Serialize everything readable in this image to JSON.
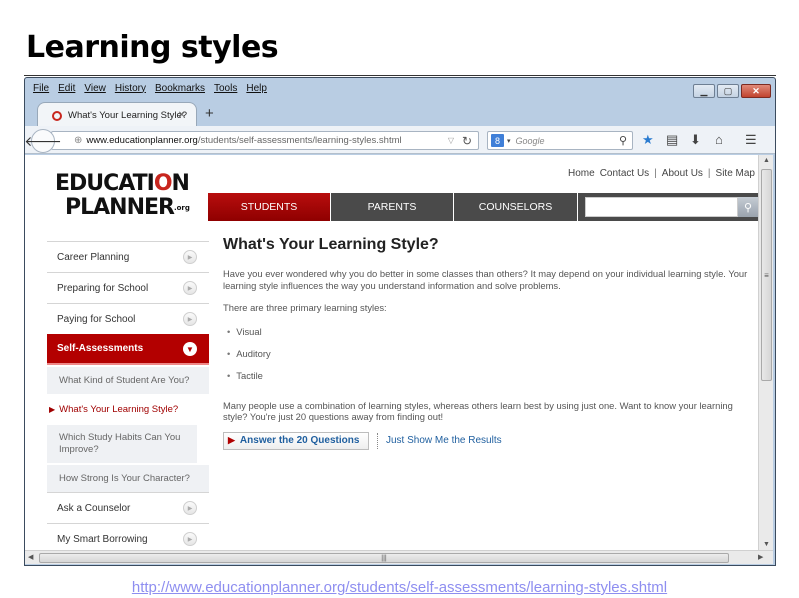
{
  "slide": {
    "title": "Learning styles",
    "source_url": "http://www.educationplanner.org/students/self-assessments/learning-styles.shtml"
  },
  "browser": {
    "menu": [
      "File",
      "Edit",
      "View",
      "History",
      "Bookmarks",
      "Tools",
      "Help"
    ],
    "tab_title": "What's Your Learning Style?",
    "tab_close": "✕",
    "new_tab": "+",
    "url_domain": "www.educationplanner.org",
    "url_path": "/students/self-assessments/learning-styles.shtml",
    "url_prefix": "www.",
    "search_engine": "Google",
    "window_controls": {
      "minimize": "▁",
      "maximize": "▢",
      "close": "✕"
    },
    "icons": {
      "back": "🡐",
      "globe": "⊕",
      "dropdown": "▽",
      "reload": "↻",
      "search": "⚲",
      "bookmark": "★",
      "reading_list": "▤",
      "download": "⬇",
      "home": "⌂",
      "menu": "☰"
    }
  },
  "site": {
    "logo": {
      "line1_a": "EDUCATI",
      "line1_o": "O",
      "line1_b": "N",
      "line2": "PLANNER",
      "org": ".org"
    },
    "util_links": [
      "Home",
      "Contact Us",
      "About Us",
      "Site Map"
    ],
    "main_nav": [
      {
        "label": "STUDENTS",
        "active": true
      },
      {
        "label": "PARENTS",
        "active": false
      },
      {
        "label": "COUNSELORS",
        "active": false
      }
    ],
    "search_placeholder": "",
    "search_icon": "🔍",
    "sidebar": {
      "items_top": [
        "Career Planning",
        "Preparing for School",
        "Paying for School"
      ],
      "active": "Self-Assessments",
      "sub_items": [
        "What Kind of Student Are You?",
        "What's Your Learning Style?",
        "Which Study Habits Can You Improve?",
        "How Strong Is Your Character?"
      ],
      "current_sub_index": 1,
      "items_bottom": [
        "Ask a Counselor",
        "My Smart Borrowing"
      ]
    },
    "content": {
      "heading": "What's Your Learning Style?",
      "intro": "Have you ever wondered why you do better in some classes than others? It may depend on your individual learning style. Your learning style influences the way you understand information and solve problems.",
      "styles_intro": "There are three primary learning styles:",
      "styles": [
        "Visual",
        "Auditory",
        "Tactile"
      ],
      "combination": "Many people use a combination of learning styles, whereas others learn best by using just one. Want to know your learning style? You're just 20 questions away from finding out!",
      "cta_primary": "Answer the 20 Questions",
      "cta_secondary": "Just Show Me the Results"
    }
  },
  "colors": {
    "brand_red": "#b30000",
    "nav_dark": "#4a4a4a",
    "link_blue": "#1f5f9f",
    "source_link": "#8e8ef0"
  }
}
